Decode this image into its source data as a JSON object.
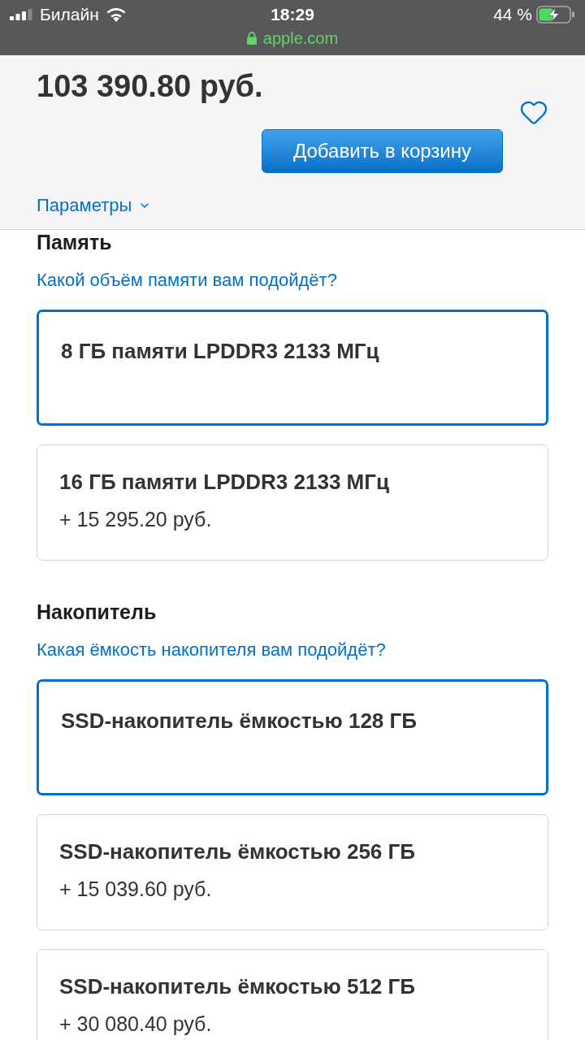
{
  "status_bar": {
    "carrier": "Билайн",
    "time": "18:29",
    "battery": "44 %",
    "charging": true,
    "secure": true,
    "url": "apple.com"
  },
  "header": {
    "price": "103 390.80 руб.",
    "favorite": false,
    "add_to_bag": "Добавить в корзину",
    "parameters": {
      "label": "Параметры",
      "expanded": false
    }
  },
  "sections": [
    {
      "title": "Память",
      "question": "Какой объём памяти вам подойдёт?",
      "options": [
        {
          "label": "8 ГБ памяти LPDDR3 2133 МГц",
          "selected": true
        },
        {
          "label": "16 ГБ памяти LPDDR3 2133 МГц",
          "price": "+ 15 295.20 руб.",
          "selected": false
        }
      ]
    },
    {
      "title": "Накопитель",
      "question": "Какая ёмкость накопителя вам подойдёт?",
      "options": [
        {
          "label": "SSD-накопитель ёмкостью 128 ГБ",
          "selected": true
        },
        {
          "label": "SSD-накопитель ёмкостью 256 ГБ",
          "price": "+ 15 039.60 руб.",
          "selected": false
        },
        {
          "label": "SSD-накопитель ёмкостью 512 ГБ",
          "price": "+ 30 080.40 руб.",
          "selected": false
        }
      ]
    }
  ]
}
